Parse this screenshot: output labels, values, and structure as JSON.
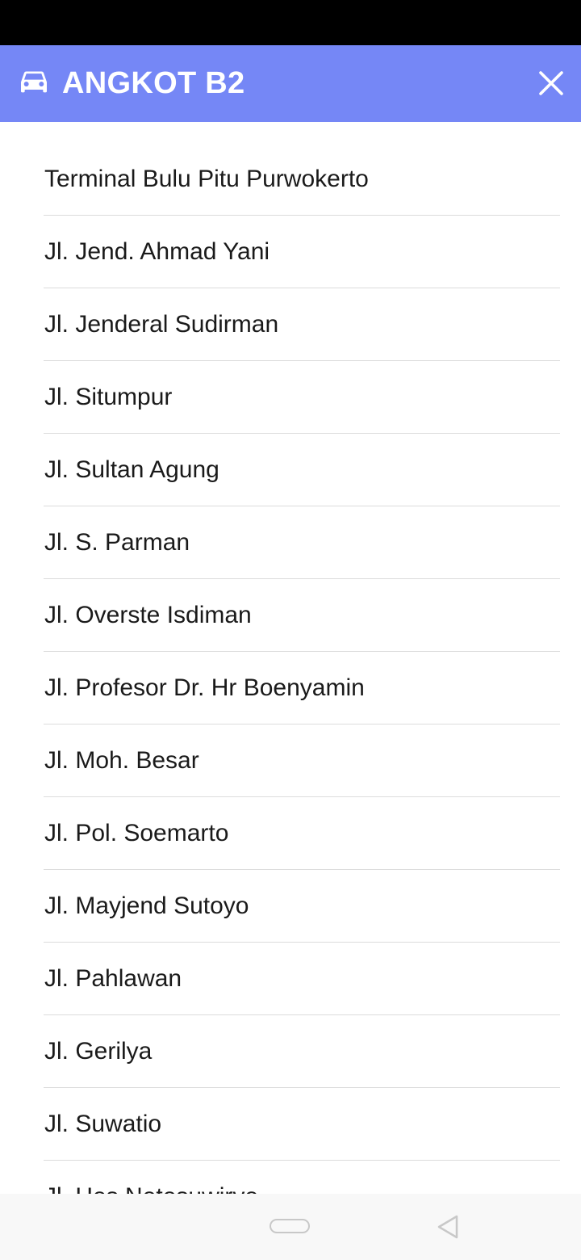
{
  "app_bar": {
    "title": "ANGKOT B2",
    "background_color": "#7587f6",
    "leading_icon": "car-icon",
    "trailing_icon": "close-icon"
  },
  "routes": [
    {
      "label": "Terminal Bulu Pitu Purwokerto"
    },
    {
      "label": "Jl. Jend. Ahmad Yani"
    },
    {
      "label": "Jl. Jenderal Sudirman"
    },
    {
      "label": "Jl. Situmpur"
    },
    {
      "label": "Jl. Sultan Agung"
    },
    {
      "label": "Jl. S. Parman"
    },
    {
      "label": "Jl. Overste Isdiman"
    },
    {
      "label": "Jl. Profesor Dr. Hr Boenyamin"
    },
    {
      "label": "Jl. Moh. Besar"
    },
    {
      "label": "Jl. Pol. Soemarto"
    },
    {
      "label": "Jl. Mayjend Sutoyo"
    },
    {
      "label": "Jl. Pahlawan"
    },
    {
      "label": "Jl. Gerilya"
    },
    {
      "label": "Jl. Suwatio"
    },
    {
      "label": "Jl. Hos Notosuwiryo"
    }
  ],
  "system_nav": {
    "home_icon": "home-pill-icon",
    "back_icon": "back-triangle-icon"
  }
}
